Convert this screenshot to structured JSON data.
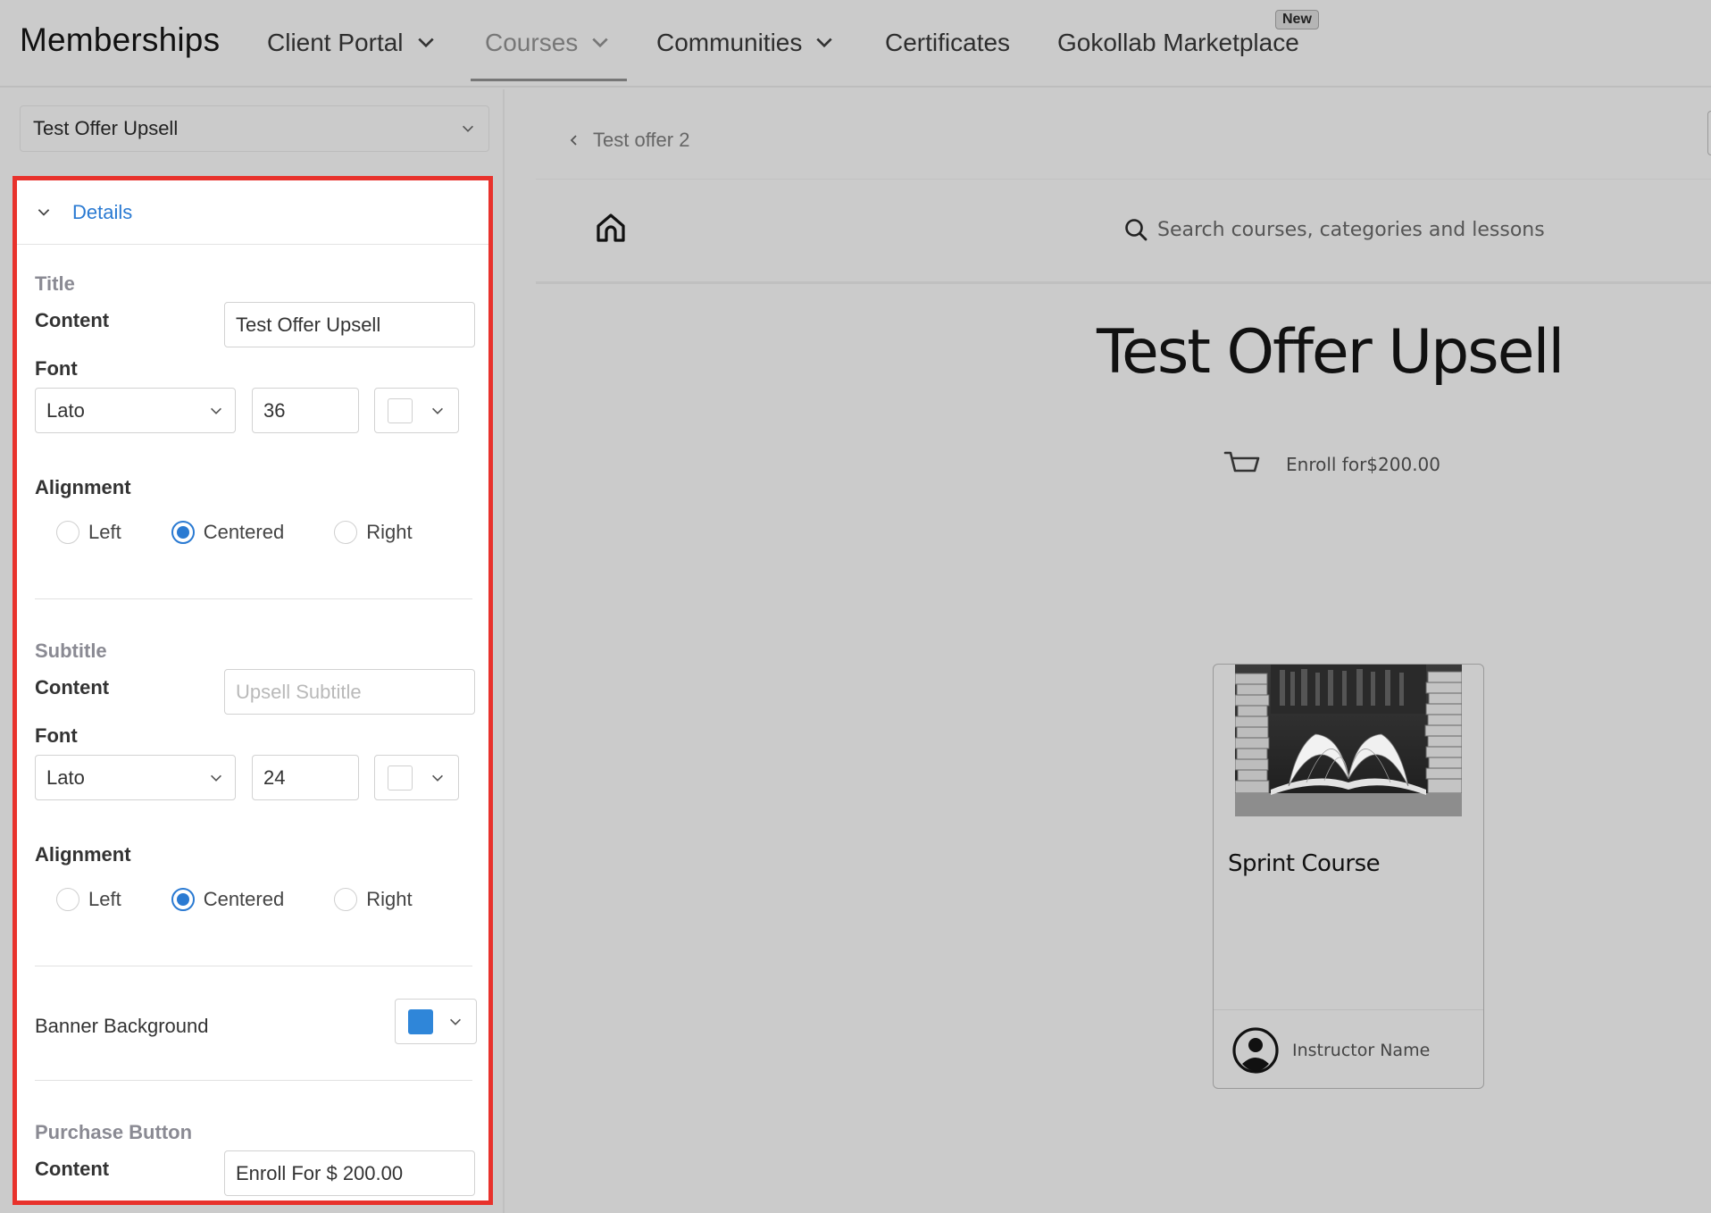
{
  "nav": {
    "brand": "Memberships",
    "items": [
      {
        "label": "Client Portal",
        "has_dropdown": true
      },
      {
        "label": "Courses",
        "has_dropdown": true,
        "active": true
      },
      {
        "label": "Communities",
        "has_dropdown": true
      },
      {
        "label": "Certificates",
        "has_dropdown": false
      },
      {
        "label": "Gokollab Marketplace",
        "has_dropdown": false,
        "badge": "New"
      }
    ]
  },
  "sidebar": {
    "offer_select": "Test Offer Upsell",
    "panel_header": "Details",
    "title_section": {
      "heading": "Title",
      "content_label": "Content",
      "content_value": "Test Offer Upsell",
      "font_label": "Font",
      "font_family": "Lato",
      "font_size": "36",
      "color": "#ffffff",
      "alignment_label": "Alignment",
      "alignment_options": [
        "Left",
        "Centered",
        "Right"
      ],
      "alignment_selected": "Centered"
    },
    "subtitle_section": {
      "heading": "Subtitle",
      "content_label": "Content",
      "content_placeholder": "Upsell Subtitle",
      "font_label": "Font",
      "font_family": "Lato",
      "font_size": "24",
      "color": "#ffffff",
      "alignment_label": "Alignment",
      "alignment_options": [
        "Left",
        "Centered",
        "Right"
      ],
      "alignment_selected": "Centered"
    },
    "banner": {
      "label": "Banner Background",
      "color": "#2f86d9"
    },
    "purchase_button": {
      "heading": "Purchase Button",
      "content_label": "Content",
      "content_value": "Enroll For $ 200.00"
    }
  },
  "preview": {
    "breadcrumb": "Test offer 2",
    "search_placeholder": "Search courses, categories and lessons",
    "title": "Test Offer Upsell",
    "enroll_label": "Enroll for$200.00",
    "card": {
      "title": "Sprint Course",
      "instructor": "Instructor Name"
    }
  },
  "colors": {
    "accent": "#2a7ad2",
    "highlight_border": "#e8322c"
  }
}
